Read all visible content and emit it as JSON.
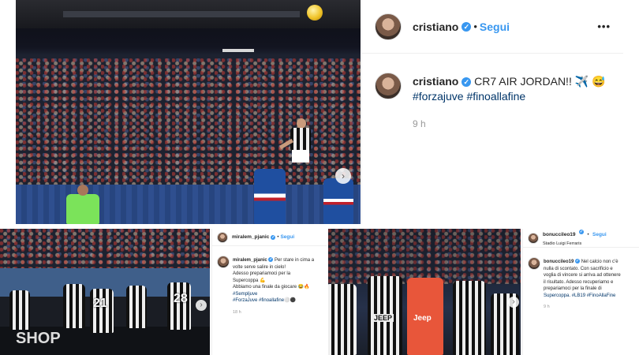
{
  "top_post": {
    "username": "cristiano",
    "follow_label": "Segui",
    "more_label": "•••",
    "caption_text": "CR7 AIR JORDAN!! ✈️ 😅",
    "hashtags": "#forzajuve #finoallafine",
    "timestamp": "9 h"
  },
  "bottom_left_post": {
    "username": "miralem_pjanic",
    "follow_label": "Segui",
    "caption_line1": "Per stare in cima a",
    "caption_line2": "volte serve salire in cielo!",
    "caption_line3": "Adesso prepariamoci per la",
    "caption_line4": "Supercoppa 💪",
    "caption_line5": "Abbiamo una finale da giocare 😂🔥",
    "caption_line6": "#Sempljuve",
    "caption_line7": "#ForzaJuve #finoallafine⚪⚫",
    "timestamp": "18 h"
  },
  "bottom_right_post": {
    "username": "bonucci​leo19",
    "follow_label": "Segui",
    "location": "Stadio Luigi Ferraris",
    "caption_line1": "Nel calcio non c'è",
    "caption_line2": "nulla di scontato. Con sacrificio e",
    "caption_line3": "voglia di vincere si arriva ad ottenere",
    "caption_line4": "il risultato. Adesso recuperiamo e",
    "caption_line5": "prepariamoci per la finale di",
    "caption_line6": "Supercoppa. #LB19 #FinoAllaFine",
    "timestamp": "9 h"
  },
  "photo_overlays": {
    "right_arrow": "›",
    "jersey_left": "JEEP",
    "jersey_right": "Jeep",
    "number_21": "21",
    "number_28": "28",
    "ad_text": "SHOP"
  },
  "colors": {
    "verified_blue": "#3897f0",
    "hashtag_blue": "#003569",
    "sampdoria_blue": "#1f4fa0",
    "keeper_green": "#7be35a"
  }
}
